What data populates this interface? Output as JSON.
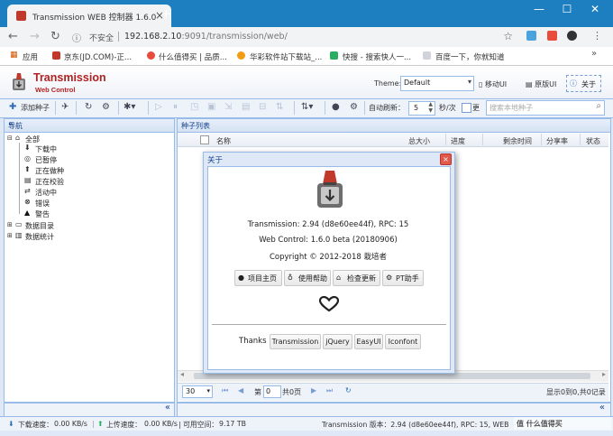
{
  "browser": {
    "tab_title": "Transmission WEB 控制器 1.6.0",
    "insecure_label": "不安全",
    "url_host": "192.168.2.10",
    "url_rest": ":9091/transmission/web/"
  },
  "bookmarks": [
    {
      "label": "应用"
    },
    {
      "label": "京东(JD.COM)-正..."
    },
    {
      "label": "什么值得买 | 品质..."
    },
    {
      "label": "华彩软件站下载站_..."
    },
    {
      "label": "快搜 - 搜索快人一..."
    },
    {
      "label": "百度一下，你就知道"
    }
  ],
  "header": {
    "brand_title": "Transmission",
    "brand_subtitle": "Web Control",
    "theme_label": "Theme:",
    "theme_value": "Default",
    "mobile_ui": "移动UI",
    "original_ui": "原版UI",
    "about": "关于"
  },
  "toolbar": {
    "add_torrent": "添加种子",
    "auto_refresh": "自动刷新：",
    "refresh_value": "5",
    "seconds_label": "秒/次",
    "checkbox_label": "更",
    "search_placeholder": "搜索本地种子"
  },
  "nav": {
    "title": "导航",
    "items": [
      {
        "label": "全部"
      },
      {
        "label": "下载中"
      },
      {
        "label": "已暂停"
      },
      {
        "label": "正在做种"
      },
      {
        "label": "正在校验"
      },
      {
        "label": "活动中"
      },
      {
        "label": "错误"
      },
      {
        "label": "警告"
      },
      {
        "label": "数据目录"
      },
      {
        "label": "数据统计"
      }
    ]
  },
  "list": {
    "title": "种子列表",
    "columns": [
      "名称",
      "总大小",
      "进度",
      "剩余时间",
      "分享率",
      "状态"
    ],
    "page_size": "30",
    "page_prefix": "第",
    "page_value": "0",
    "page_suffix": "共0页",
    "summary": "显示0到0,共0记录"
  },
  "about_dialog": {
    "title": "关于",
    "line1": "Transmission: 2.94 (d8e60ee44f), RPC: 15",
    "line2": "Web Control: 1.6.0 beta (20180906)",
    "line3": "Copyright © 2012-2018 栽培者",
    "links": [
      "项目主页",
      "使用帮助",
      "检查更新",
      "PT助手"
    ],
    "thanks_label": "Thanks :",
    "thanks": [
      "Transmission",
      "jQuery",
      "EasyUI",
      "Iconfont"
    ]
  },
  "status": {
    "download": "下载速度：",
    "download_value": "0.00 KB/s",
    "upload": "上传速度：",
    "upload_value": "0.00 KB/s",
    "free_space": "| 可用空间：",
    "free_value": "9.17 TB",
    "version": "Transmission 版本：2.94 (d8e60ee44f), RPC: 15, WEB",
    "watermark": "值 什么值得买"
  },
  "colors": {
    "brand_red": "#b22222",
    "chrome_blue": "#1e7fc0",
    "panel_border": "#99bbe8"
  }
}
